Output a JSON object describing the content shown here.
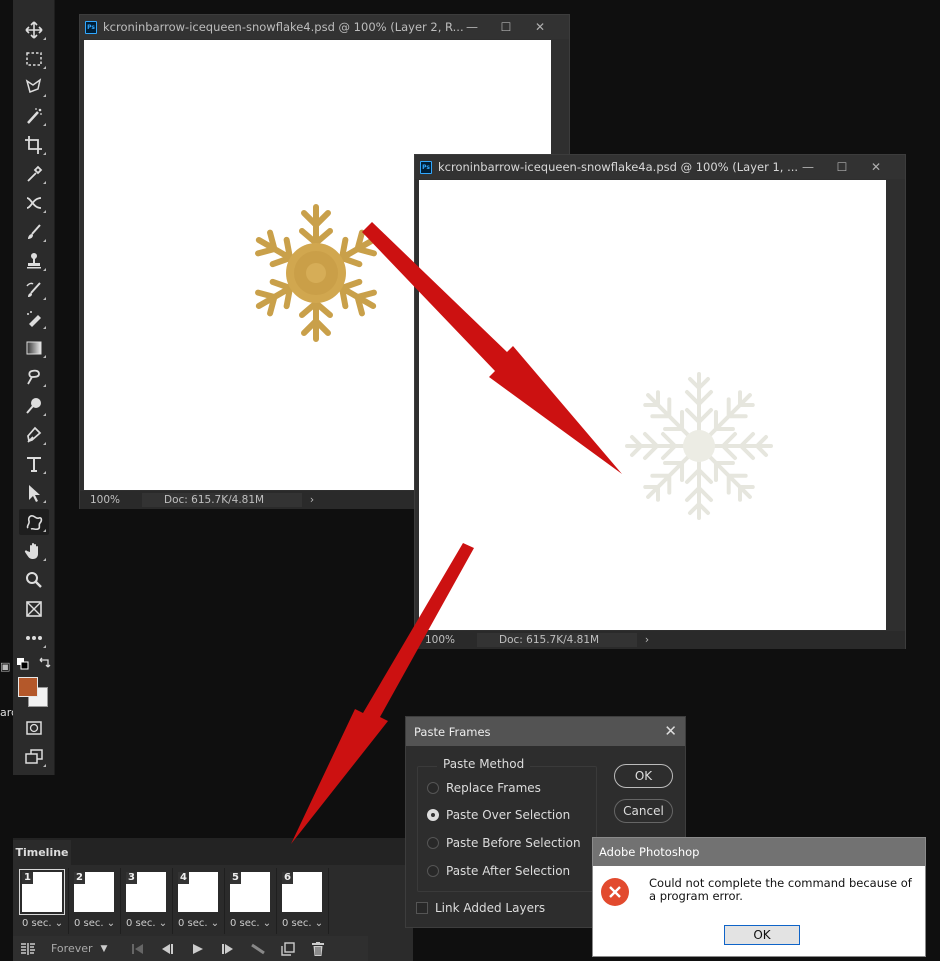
{
  "toolbar": {
    "tools": [
      {
        "name": "move-tool",
        "icon": "move-icon"
      },
      {
        "name": "marquee-tool",
        "icon": "rectangular-marquee-icon"
      },
      {
        "name": "lasso-tool",
        "icon": "polygonal-lasso-icon"
      },
      {
        "name": "magic-wand-tool",
        "icon": "magic-wand-icon"
      },
      {
        "name": "crop-tool",
        "icon": "crop-icon"
      },
      {
        "name": "eyedropper-tool",
        "icon": "eyedropper-icon"
      },
      {
        "name": "healing-tool",
        "icon": "healing-brush-icon"
      },
      {
        "name": "brush-tool",
        "icon": "brush-icon"
      },
      {
        "name": "clone-stamp-tool",
        "icon": "clone-stamp-icon"
      },
      {
        "name": "history-brush-tool",
        "icon": "history-brush-icon"
      },
      {
        "name": "eraser-tool",
        "icon": "eraser-icon"
      },
      {
        "name": "gradient-tool",
        "icon": "gradient-icon"
      },
      {
        "name": "smudge-tool",
        "icon": "smudge-icon"
      },
      {
        "name": "dodge-tool",
        "icon": "dodge-icon"
      },
      {
        "name": "pen-tool",
        "icon": "pen-icon"
      },
      {
        "name": "type-tool",
        "icon": "type-icon",
        "glyph": "T"
      },
      {
        "name": "path-selection-tool",
        "icon": "arrow-cursor-icon"
      },
      {
        "name": "custom-shape-tool",
        "icon": "custom-shape-icon",
        "active": true
      },
      {
        "name": "hand-tool",
        "icon": "hand-icon"
      },
      {
        "name": "zoom-tool",
        "icon": "zoom-icon"
      },
      {
        "name": "frame-tool",
        "icon": "frame-icon"
      },
      {
        "name": "more-tools",
        "icon": "ellipsis-icon",
        "glyph": "•••"
      }
    ],
    "foreground_color": "#b4582a",
    "background_color": "#f2f2f2",
    "edge_text": "arc"
  },
  "doc1": {
    "title": "kcroninbarrow-icequeen-snowflake4.psd @ 100% (Layer 2, R...",
    "badge": "Ps",
    "zoom": "100%",
    "doc_info": "Doc: 615.7K/4.81M",
    "arrow": "›"
  },
  "doc2": {
    "title": "kcroninbarrow-icequeen-snowflake4a.psd @ 100% (Layer 1, ...",
    "badge": "Ps",
    "zoom": "100%",
    "doc_info": "Doc: 615.7K/4.81M",
    "arrow": "›"
  },
  "window_controls": {
    "minimize": "—",
    "maximize": "☐",
    "close": "✕"
  },
  "timeline": {
    "tab_label": "Timeline",
    "frames": [
      {
        "num": "1",
        "delay": "0 sec.",
        "selected": true
      },
      {
        "num": "2",
        "delay": "0 sec."
      },
      {
        "num": "3",
        "delay": "0 sec."
      },
      {
        "num": "4",
        "delay": "0 sec."
      },
      {
        "num": "5",
        "delay": "0 sec."
      },
      {
        "num": "6",
        "delay": "0 sec."
      }
    ],
    "delay_caret": "⌄",
    "loop": "Forever",
    "loop_caret": "▼"
  },
  "paste_frames": {
    "title": "Paste Frames",
    "close": "✕",
    "group_label": "Paste Method",
    "options": [
      {
        "label": "Replace Frames",
        "checked": false
      },
      {
        "label": "Paste Over Selection",
        "checked": true
      },
      {
        "label": "Paste Before Selection",
        "checked": false
      },
      {
        "label": "Paste After Selection",
        "checked": false
      }
    ],
    "ok": "OK",
    "cancel": "Cancel",
    "link_layers": "Link Added Layers",
    "link_layers_checked": false
  },
  "alert": {
    "title": "Adobe Photoshop",
    "message": "Could not complete the command because of a program error.",
    "ok": "OK"
  },
  "annotation_color": "#cc1111"
}
